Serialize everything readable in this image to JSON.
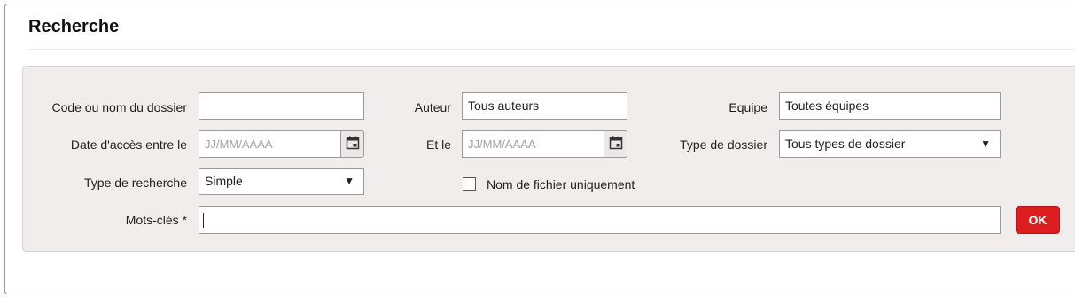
{
  "panel": {
    "title": "Recherche"
  },
  "form": {
    "dossier": {
      "label": "Code ou nom du dossier",
      "value": ""
    },
    "auteur": {
      "label": "Auteur",
      "value": "Tous auteurs"
    },
    "equipe": {
      "label": "Equipe",
      "value": "Toutes équipes"
    },
    "date_acces": {
      "label": "Date d'accès entre le",
      "placeholder": "JJ/MM/AAAA",
      "icon": "calendar-icon"
    },
    "et_le": {
      "label": "Et le",
      "placeholder": "JJ/MM/AAAA",
      "icon": "calendar-icon"
    },
    "type_dossier": {
      "label": "Type de dossier",
      "selected": "Tous types de dossier"
    },
    "type_recherche": {
      "label": "Type de recherche",
      "selected": "Simple"
    },
    "nom_fichier": {
      "label": "Nom de fichier uniquement",
      "checked": false
    },
    "mots_cles": {
      "label": "Mots-clés *",
      "value": ""
    },
    "submit_label": "OK"
  },
  "colors": {
    "accent": "#dc1e21",
    "form_background": "#f1edec"
  }
}
